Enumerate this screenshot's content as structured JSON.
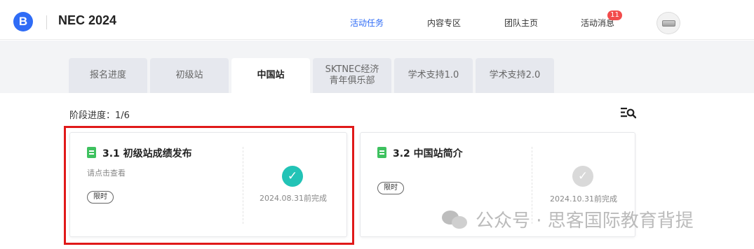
{
  "header": {
    "logo_letter": "B",
    "title": "NEC 2024",
    "nav": [
      {
        "label": "活动任务",
        "active": true
      },
      {
        "label": "内容专区",
        "active": false
      },
      {
        "label": "团队主页",
        "active": false
      },
      {
        "label": "活动消息",
        "active": false
      }
    ],
    "message_badge": "11"
  },
  "tabs": [
    {
      "label": "报名进度",
      "active": false
    },
    {
      "label": "初级站",
      "active": false
    },
    {
      "label": "中国站",
      "active": true
    },
    {
      "line1": "SKTNEC经济",
      "line2": "青年俱乐部",
      "active": false
    },
    {
      "label": "学术支持1.0",
      "active": false
    },
    {
      "label": "学术支持2.0",
      "active": false
    }
  ],
  "progress_label": "阶段进度：1/6",
  "cards": [
    {
      "title": "3.1 初级站成绩发布",
      "hint": "请点击查看",
      "tag": "限时",
      "due": "2024.08.31前完成",
      "completed": true,
      "highlighted": true
    },
    {
      "title": "3.2 中国站简介",
      "tag": "限时",
      "due": "2024.10.31前完成",
      "completed": false,
      "highlighted": false
    }
  ],
  "watermark": "公众号 · 思客国际教育背提",
  "colors": {
    "accent": "#2f6cf6",
    "check_done": "#22c3b6",
    "check_pending": "#d9d9d9",
    "badge": "#f24c4c",
    "highlight": "#e01919"
  }
}
